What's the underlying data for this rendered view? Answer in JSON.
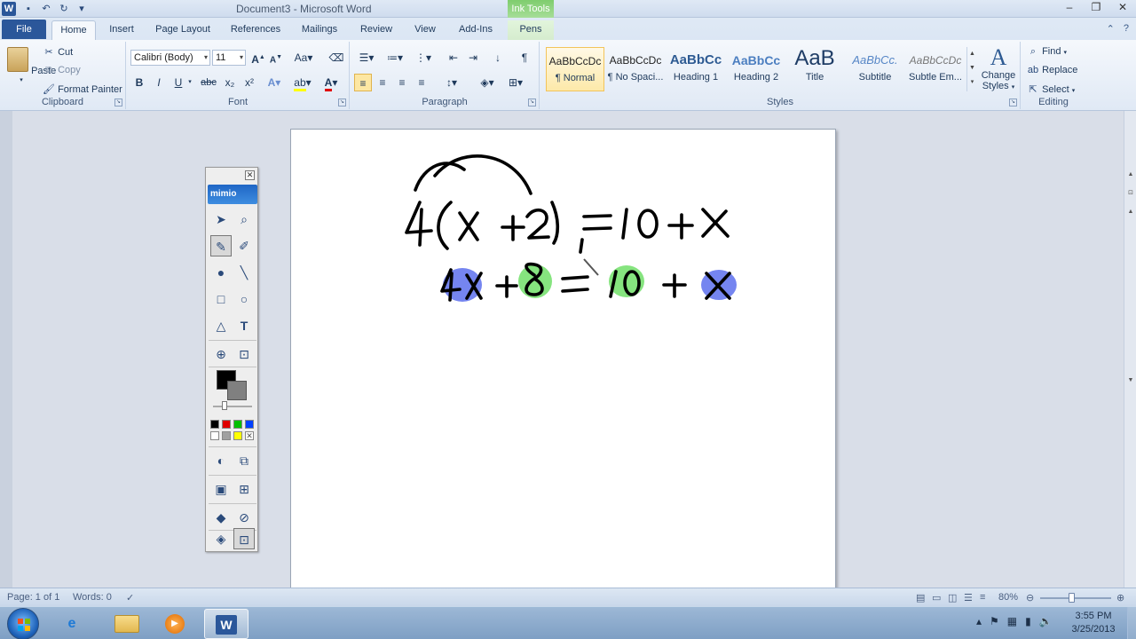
{
  "window": {
    "title": "Document3 - Microsoft Word",
    "context_tab": "Ink Tools",
    "minimize": "–",
    "restore": "❐",
    "close": "✕"
  },
  "tabs": {
    "file": "File",
    "home": "Home",
    "insert": "Insert",
    "page_layout": "Page Layout",
    "references": "References",
    "mailings": "Mailings",
    "review": "Review",
    "view": "View",
    "addins": "Add-Ins",
    "pens": "Pens"
  },
  "clipboard": {
    "label": "Clipboard",
    "paste": "Paste",
    "cut": "Cut",
    "copy": "Copy",
    "format_painter": "Format Painter"
  },
  "font": {
    "label": "Font",
    "family": "Calibri (Body)",
    "size": "11",
    "bold": "B",
    "italic": "I",
    "underline": "U",
    "strike": "abc",
    "subscript": "x₂",
    "superscript": "x²"
  },
  "paragraph": {
    "label": "Paragraph"
  },
  "styles": {
    "label": "Styles",
    "items": [
      {
        "sample": "AaBbCcDc",
        "name": "¶ Normal"
      },
      {
        "sample": "AaBbCcDc",
        "name": "¶ No Spaci..."
      },
      {
        "sample": "AaBbCc",
        "name": "Heading 1"
      },
      {
        "sample": "AaBbCc",
        "name": "Heading 2"
      },
      {
        "sample": "AaB",
        "name": "Title"
      },
      {
        "sample": "AaBbCc.",
        "name": "Subtitle"
      },
      {
        "sample": "AaBbCcDc",
        "name": "Subtle Em..."
      }
    ],
    "change_styles": "Change Styles",
    "change_styles_line1": "Change",
    "change_styles_line2": "Styles"
  },
  "editing": {
    "label": "Editing",
    "find": "Find",
    "replace": "Replace",
    "select": "Select"
  },
  "mimio": {
    "logo": "mimio"
  },
  "status": {
    "page": "Page: 1 of 1",
    "words": "Words: 0",
    "zoom": "80%"
  },
  "taskbar": {
    "time": "3:55 PM",
    "date": "3/25/2013"
  },
  "colors": {
    "file_tab": "#2b579a",
    "ink_tools": "#7fcd6e",
    "highlight_blue": "#6b7cf0",
    "highlight_green": "#7de07a",
    "ink": "#000000"
  }
}
